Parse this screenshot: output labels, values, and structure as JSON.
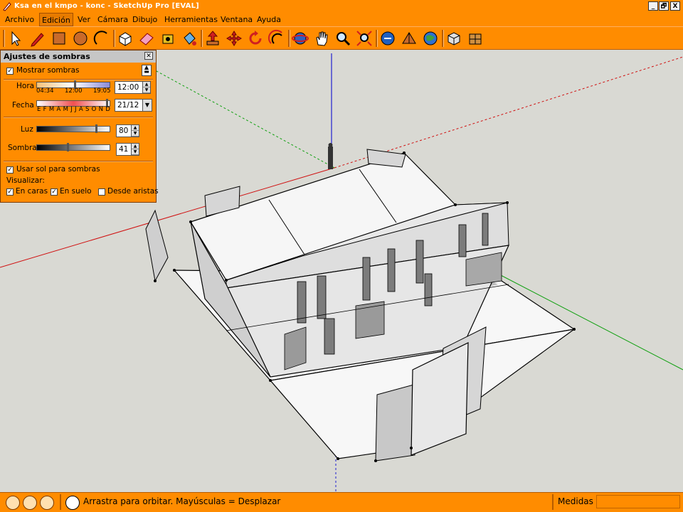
{
  "window": {
    "title": "Ksa en el kmpo - konc - SketchUp Pro [EVAL]",
    "controls": [
      "_",
      "🗗",
      "X"
    ]
  },
  "menu": [
    "Archivo",
    "Edición",
    "Ver",
    "Cámara",
    "Dibujo",
    "Herramientas",
    "Ventana",
    "Ayuda"
  ],
  "menu_active": "Edición",
  "toolbar": {
    "tools": [
      "select-icon",
      "pencil-icon",
      "rectangle-icon",
      "circle-icon",
      "arc-icon",
      "make-component-icon",
      "eraser-icon",
      "tape-measure-icon",
      "paint-bucket-icon",
      "push-pull-icon",
      "move-icon",
      "rotate-icon",
      "offset-icon",
      "orbit-icon",
      "pan-icon",
      "zoom-icon",
      "zoom-extents-icon",
      "get-models-icon",
      "share-model-icon",
      "google-earth-icon",
      "component-browser-icon",
      "material-browser-icon"
    ]
  },
  "shadow_dialog": {
    "title": "Ajustes de sombras",
    "show_shadows_label": "Mostrar sombras",
    "show_shadows_checked": true,
    "time_label": "Hora",
    "time_ticks": [
      "04:34",
      "12:00",
      "19:05"
    ],
    "time_value": "12:00",
    "date_label": "Fecha",
    "date_months": "E F M A M J J A S O N D",
    "date_value": "21/12",
    "light_label": "Luz",
    "light_value": "80",
    "light_level": 0.8,
    "dark_label": "Sombra",
    "dark_value": "41",
    "dark_level": 0.41,
    "use_sun_label": "Usar sol para sombras",
    "use_sun_checked": true,
    "display_label": "Visualizar:",
    "on_faces_label": "En caras",
    "on_faces_checked": true,
    "on_ground_label": "En suelo",
    "on_ground_checked": true,
    "from_edges_label": "Desde aristas",
    "from_edges_checked": false
  },
  "statusbar": {
    "hint": "Arrastra para orbitar. Mayúsculas = Desplazar",
    "measures_label": "Medidas",
    "measures_value": ""
  },
  "colors": {
    "chrome": "#ff8c00",
    "viewport_bg": "#d9d9d3",
    "axis_red": "#d01010",
    "axis_green": "#10a010",
    "axis_blue": "#2020d0"
  }
}
